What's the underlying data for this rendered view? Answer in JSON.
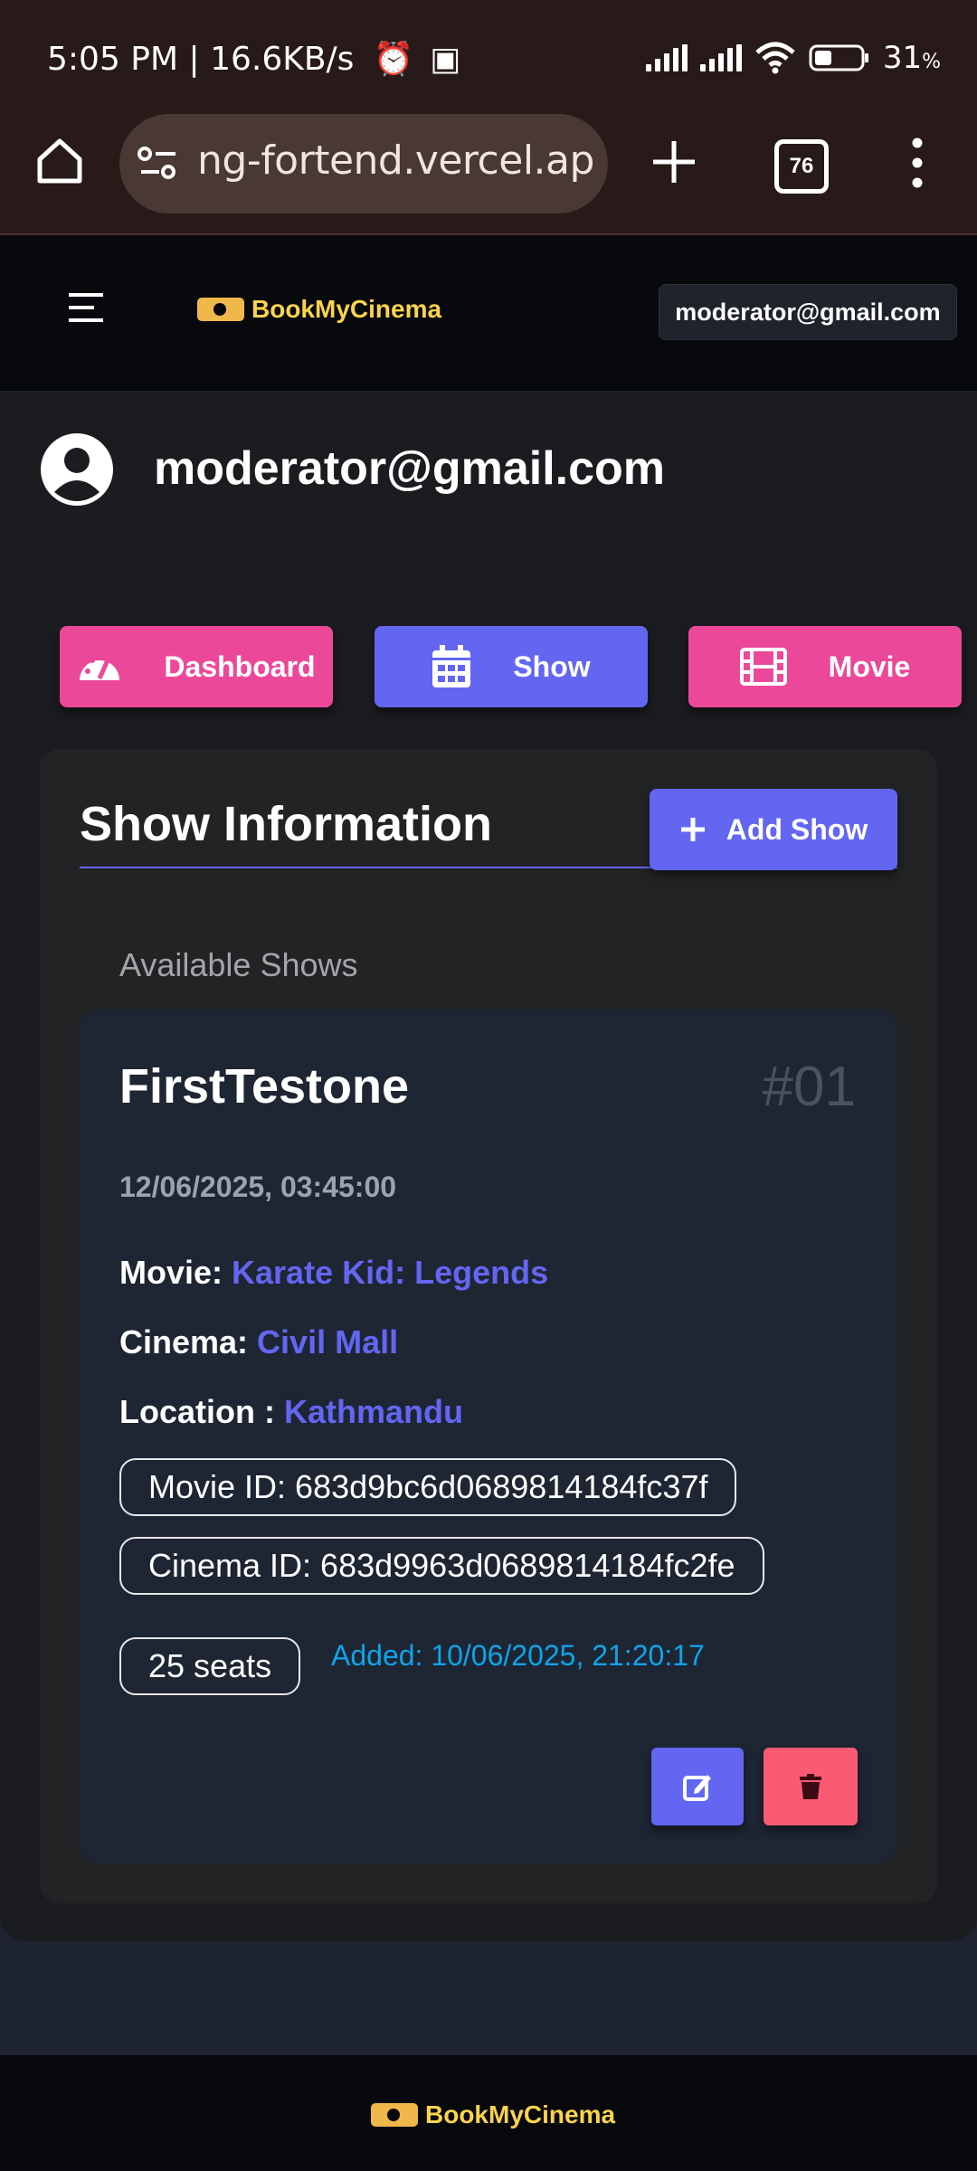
{
  "status_bar": {
    "time": "5:05 PM | 16.6KB/s",
    "battery": "31"
  },
  "browser": {
    "url": "ng-fortend.vercel.app",
    "tab_count": "76"
  },
  "header": {
    "brand": "BookMyCinema",
    "user_email": "moderator@gmail.com"
  },
  "profile": {
    "email": "moderator@gmail.com"
  },
  "tabs": {
    "dashboard": "Dashboard",
    "show": "Show",
    "movie": "Movie"
  },
  "show_info": {
    "title": "Show Information",
    "add_button": "Add Show",
    "list_heading": "Available Shows"
  },
  "show_card": {
    "name": "FirstTestone",
    "number": "#01",
    "datetime": "12/06/2025, 03:45:00",
    "movie_label": "Movie:",
    "movie_value": "Karate Kid: Legends",
    "cinema_label": "Cinema:",
    "cinema_value": "Civil Mall",
    "location_label": "Location :",
    "location_value": "Kathmandu",
    "movie_id": "Movie ID: 683d9bc6d0689814184fc37f",
    "cinema_id": "Cinema ID: 683d9963d0689814184fc2fe",
    "seats": "25 seats",
    "added": "Added: 10/06/2025, 21:20:17"
  },
  "footer": {
    "brand": "BookMyCinema"
  },
  "colors": {
    "accent": "#6366f1",
    "pink": "#ec4899",
    "danger": "#fb5a73",
    "info": "#0ea5e9",
    "brand_yellow": "#fcd34d"
  }
}
